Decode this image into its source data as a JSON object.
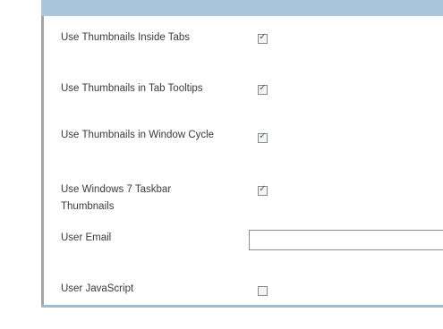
{
  "settings": [
    {
      "label": "Use Thumbnails Inside Tabs",
      "checked": true
    },
    {
      "label": "Use Thumbnails in Tab Tooltips",
      "checked": true
    },
    {
      "label": "Use Thumbnails in Window Cycle",
      "checked": true
    },
    {
      "label": "Use Windows 7 Taskbar Thumbnails",
      "checked": true
    },
    {
      "label": "User Email",
      "value": ""
    },
    {
      "label": "User JavaScript",
      "checked": false
    }
  ],
  "colors": {
    "header_bar": "#a9c6dc",
    "border": "#a3a3a3",
    "text": "#3a3a3a"
  }
}
